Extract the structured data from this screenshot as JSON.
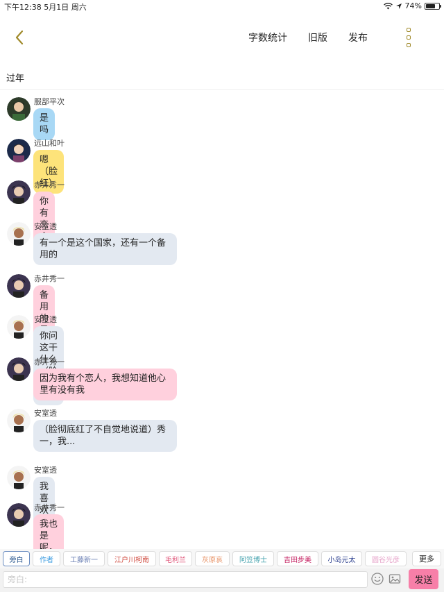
{
  "status_bar": {
    "time_date": "下午12:38  5月1日 周六",
    "battery_text": "74%",
    "battery_level": 0.74
  },
  "header": {
    "back_icon": "chevron-left-icon",
    "actions": [
      "字数统计",
      "旧版",
      "发布"
    ],
    "more_icon": "more-vertical-icon",
    "accent_color": "#a08a2a"
  },
  "chapter_title": "过年",
  "messages": [
    {
      "speaker": "服部平次",
      "text": "是吗",
      "color": "blue"
    },
    {
      "speaker": "远山和叶",
      "text": "嗯（脸红）",
      "color": "yellow"
    },
    {
      "speaker": "赤井秀一",
      "text": "你有恋人吗",
      "color": "pink"
    },
    {
      "speaker": "安室透",
      "text": "有一个是这个国家，还有一个备用的",
      "color": "gray"
    },
    {
      "speaker": "赤井秀一",
      "text": "备用的是谁呢",
      "color": "pink"
    },
    {
      "speaker": "安室透",
      "text": "你问这干什么（脸有点红）",
      "color": "gray"
    },
    {
      "speaker": "赤井秀一",
      "text": "因为我有个恋人，我想知道他心里有没有我",
      "color": "pink"
    },
    {
      "speaker": "安室透",
      "text": "（脸彻底红了不自觉地说道）秀一，我...",
      "color": "gray"
    },
    {
      "speaker": "安室透",
      "text": "我喜欢你",
      "color": "gray"
    },
    {
      "speaker": "赤井秀一",
      "text": "我也是呢，公安",
      "color": "pink"
    }
  ],
  "characters": [
    {
      "label": "旁白",
      "color": "#1f4f8a",
      "selected": true
    },
    {
      "label": "作者",
      "color": "#3a9be0"
    },
    {
      "label": "工藤新一",
      "color": "#6a7fb4"
    },
    {
      "label": "江户川柯南",
      "color": "#d04a3f"
    },
    {
      "label": "毛利兰",
      "color": "#e0567a"
    },
    {
      "label": "灰原哀",
      "color": "#e8956a"
    },
    {
      "label": "阿笠博士",
      "color": "#4aa5b0"
    },
    {
      "label": "吉田步美",
      "color": "#c2185b"
    },
    {
      "label": "小岛元太",
      "color": "#283c8c"
    },
    {
      "label": "圆谷光彦",
      "color": "#e6a2c8"
    }
  ],
  "more_label": "更多",
  "input": {
    "placeholder": "旁白:",
    "emoji_icon": "emoji-icon",
    "image_icon": "image-icon",
    "send_label": "发送",
    "send_color": "#f77fa8"
  }
}
